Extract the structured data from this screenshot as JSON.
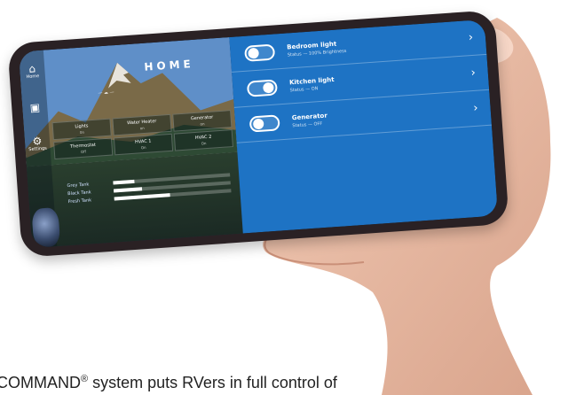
{
  "app": {
    "title": "HOME"
  },
  "weather": {
    "text": "—  ☁  —"
  },
  "nav": [
    {
      "label": "Home",
      "icon": "home-icon",
      "glyph": "⌂"
    },
    {
      "label": "",
      "icon": "image-icon",
      "glyph": "▣"
    },
    {
      "label": "Settings",
      "icon": "gear-icon",
      "glyph": "⚙"
    }
  ],
  "tiles": [
    {
      "label": "Lights",
      "sub": "0n"
    },
    {
      "label": "Water Heater",
      "sub": "on"
    },
    {
      "label": "Generator",
      "sub": "on"
    },
    {
      "label": "Thermostat",
      "sub": "Off"
    },
    {
      "label": "HVAC 1",
      "sub": "On"
    },
    {
      "label": "HVAC 2",
      "sub": "On"
    }
  ],
  "tanks": [
    {
      "label": "Grey Tank",
      "fill": 0.18
    },
    {
      "label": "Black Tank",
      "fill": 0.24
    },
    {
      "label": "Fresh Tank",
      "fill": 0.48
    }
  ],
  "footer_note": "",
  "devices": [
    {
      "title": "Bedroom light",
      "status": "Status — 100% Brightness",
      "state": "off"
    },
    {
      "title": "Kitchen light",
      "status": "Status — ON",
      "state": "on"
    },
    {
      "title": "Generator",
      "status": "Status — OFF",
      "state": "off"
    }
  ],
  "caption": {
    "before": "COMMAND",
    "sup": "®",
    "after": " system puts RVers in full control of"
  },
  "colors": {
    "accent": "#1e73c4"
  }
}
